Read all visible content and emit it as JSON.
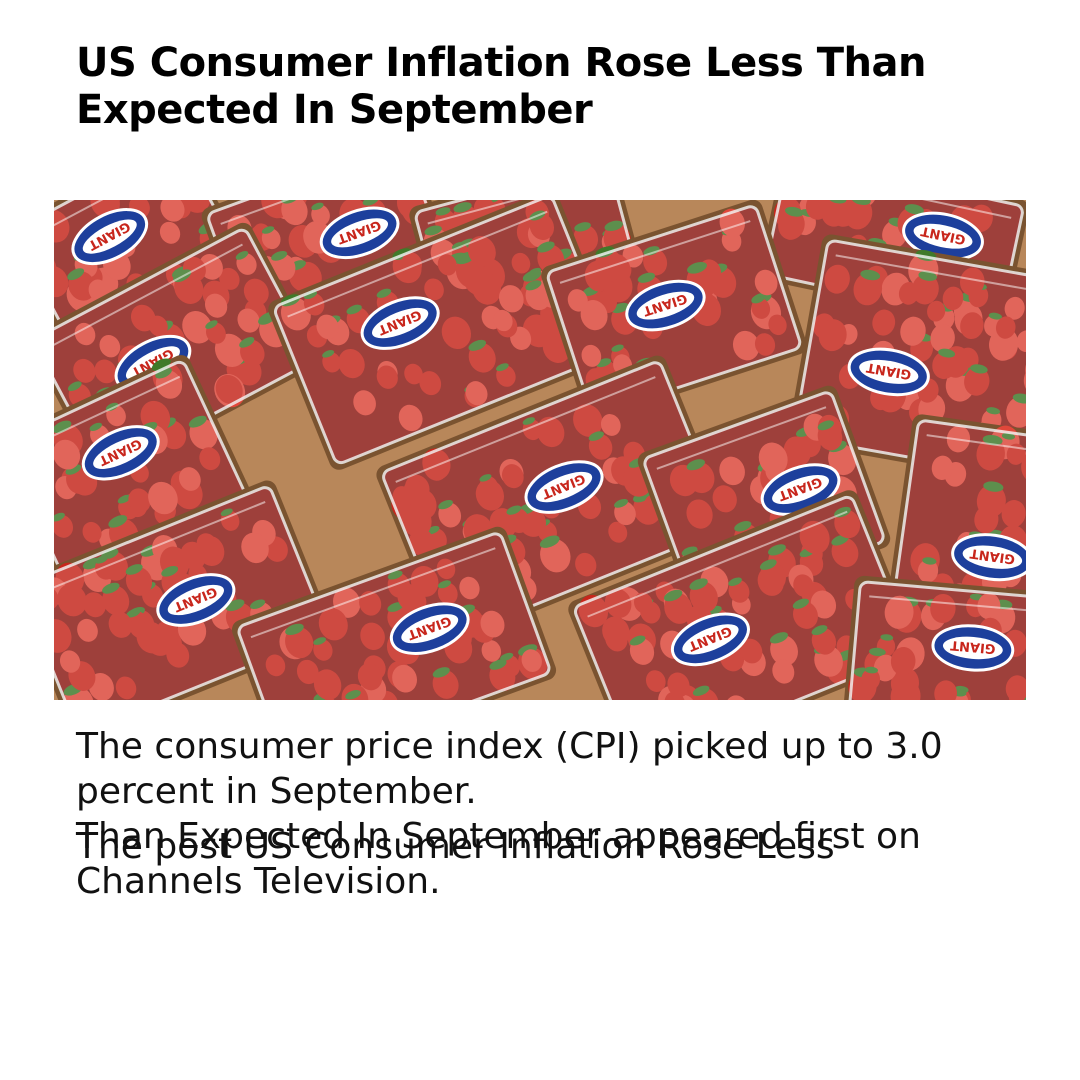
{
  "article": {
    "title": "US Consumer Inflation Rose Less Than Expected In September",
    "summary": "The consumer price index (CPI) picked up to 3.0 percent in September.",
    "footer_line_a": "Than Expected In September appeared first on Channels Television.",
    "footer_line_b": "The post US Consumer Inflation Rose Less"
  },
  "photo": {
    "subject": "clamshell packs of strawberries in cardboard trays",
    "label_text": "GIANT",
    "colors": {
      "cardboard": "#b8875a",
      "strawberry": "#c8261c",
      "plastic": "#e9eef0",
      "label_blue": "#1d3f9c"
    }
  }
}
